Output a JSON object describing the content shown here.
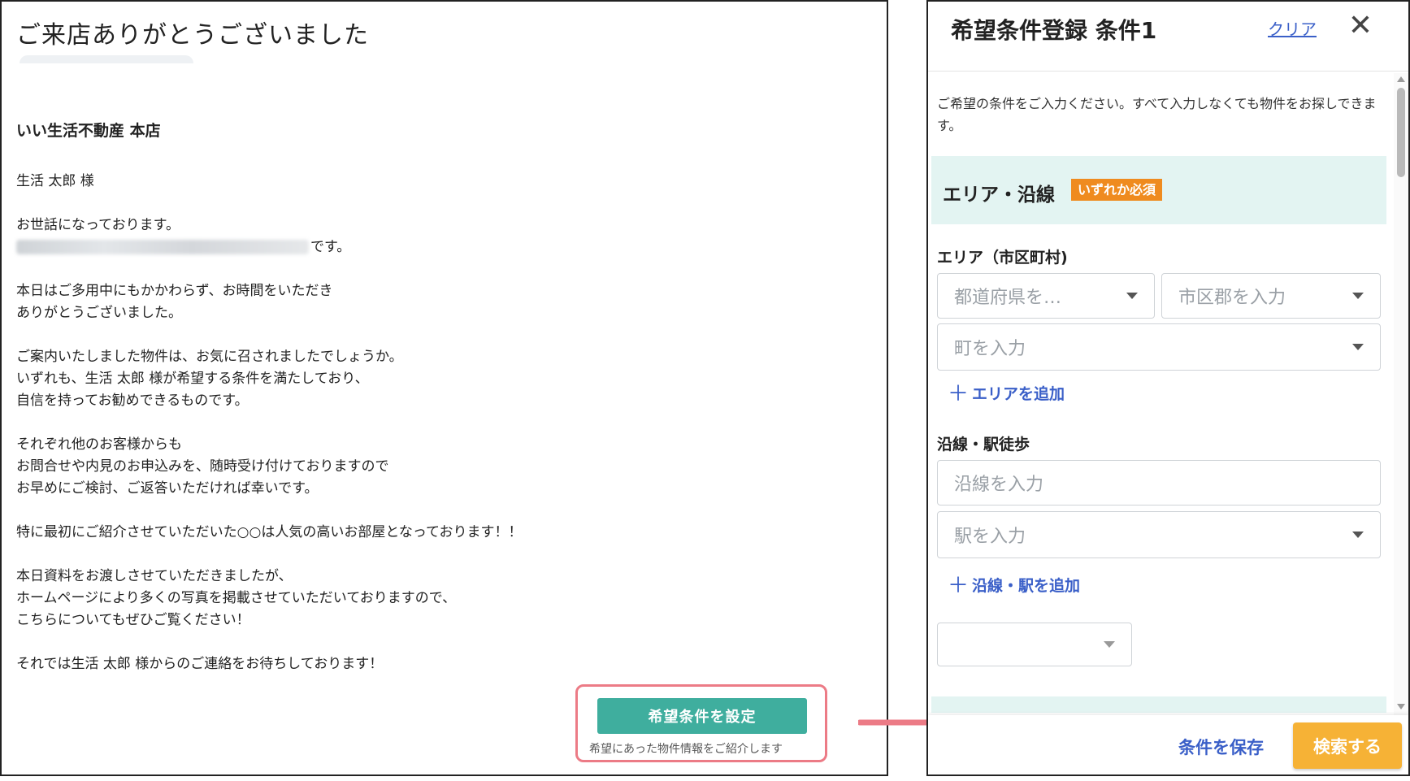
{
  "email": {
    "title": "ご来店ありがとうございました",
    "shop_name": "いい生活不動産 本店",
    "greeting": "生活 太郎 様",
    "p2_line1": "お世話になっております。",
    "p2_line2_suffix": "です。",
    "p3_line1": "本日はご多用中にもかかわらず、お時間をいただき",
    "p3_line2": "ありがとうございました。",
    "p4_line1": "ご案内いたしました物件は、お気に召されましたでしょうか。",
    "p4_line2": "いずれも、生活 太郎 様が希望する条件を満たしており、",
    "p4_line3": "自信を持ってお勧めできるものです。",
    "p5_line1": "それぞれ他のお客様からも",
    "p5_line2": "お問合せや内見のお申込みを、随時受け付けておりますので",
    "p5_line3": "お早めにご検討、ご返答いただければ幸いです。",
    "p6_line1": "特に最初にご紹介させていただいた○○は人気の高いお部屋となっております！！",
    "p7_line1": "本日資料をお渡しさせていただきましたが、",
    "p7_line2": "ホームページにより多くの写真を掲載させていただいておりますので、",
    "p7_line3": "こちらについてもぜひご覧ください！",
    "p8_line1": "それでは生活 太郎 様からのご連絡をお待ちしております！",
    "cta_button": "希望条件を設定",
    "cta_note": "希望にあった物件情報をご紹介します"
  },
  "panel": {
    "title": "希望条件登録 条件1",
    "clear_label": "クリア",
    "close_glyph": "✕",
    "description": "ご希望の条件をご入力ください。すべて入力しなくても物件をお探しできます。",
    "section_title": "エリア・沿線",
    "required_badge": "いずれか必須",
    "area_label": "エリア（市区町村)",
    "prefecture_placeholder": "都道府県を…",
    "city_placeholder": "市区郡を入力",
    "town_placeholder": "町を入力",
    "add_area": "エリアを追加",
    "line_label": "沿線・駅徒歩",
    "line_placeholder": "沿線を入力",
    "station_placeholder": "駅を入力",
    "add_line": "沿線・駅を追加",
    "walk_placeholder": "",
    "plus_glyph": "＋",
    "save_label": "条件を保存",
    "search_label": "検索する"
  },
  "colors": {
    "cta_green": "#3fae9e",
    "highlight_pink": "#ec7b86",
    "link_blue": "#3a5fc8",
    "badge_orange": "#ef8b1f",
    "search_yellow": "#f6b236",
    "section_teal": "#e3f4f2"
  }
}
